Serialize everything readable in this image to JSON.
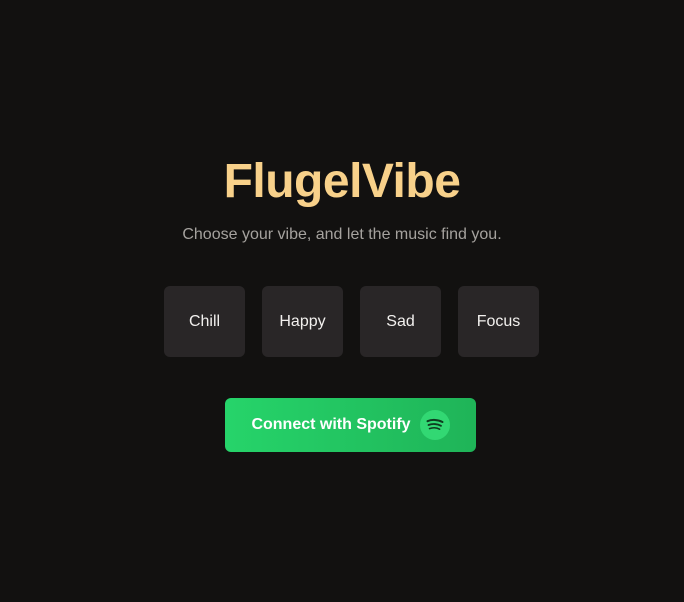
{
  "app": {
    "title": "FlugelVibe",
    "subtitle": "Choose your vibe, and let the music find you."
  },
  "moods": [
    {
      "label": "Chill"
    },
    {
      "label": "Happy"
    },
    {
      "label": "Sad"
    },
    {
      "label": "Focus"
    }
  ],
  "connect_button": {
    "label": "Connect with Spotify",
    "icon": "spotify-icon"
  },
  "colors": {
    "background": "#121110",
    "title": "#f8d18a",
    "subtitle": "#a5a29e",
    "mood_tile": "#292627",
    "spotify_green": "#1fb458"
  }
}
